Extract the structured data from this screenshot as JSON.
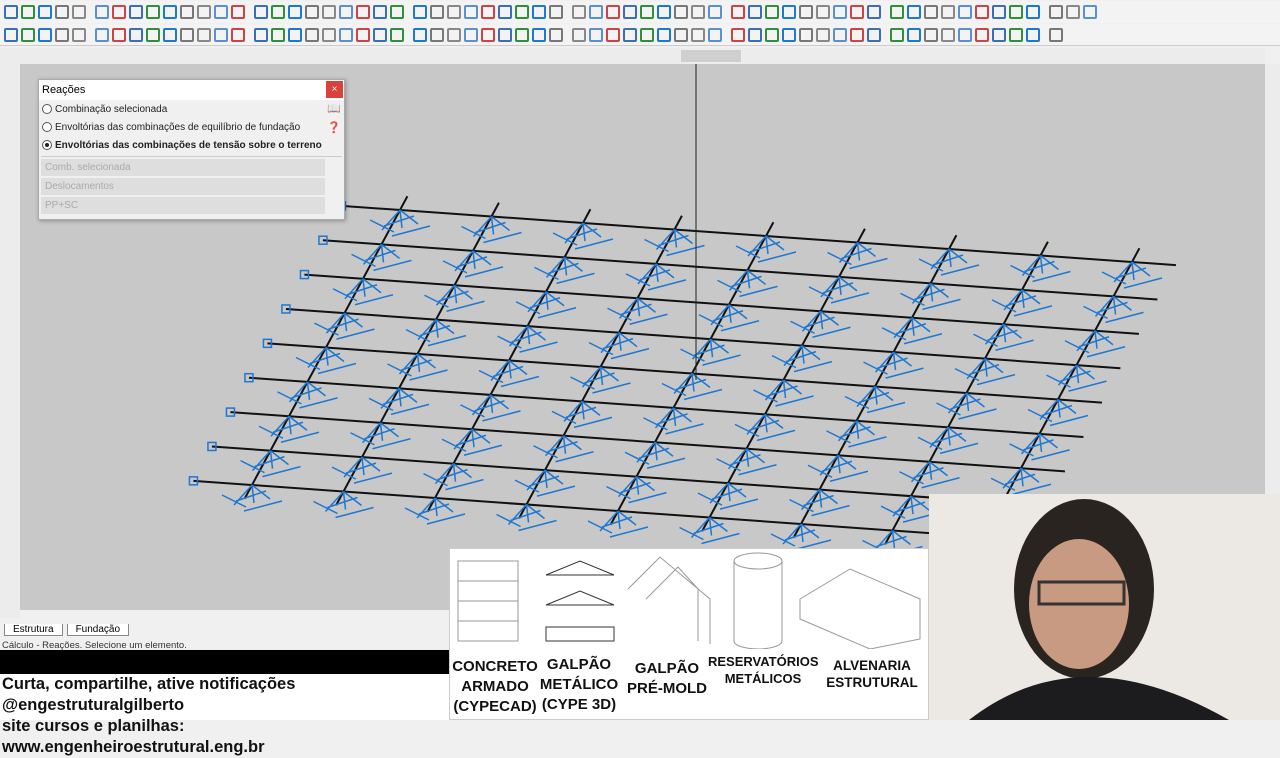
{
  "toolbar": {
    "row1_icon_count": 62,
    "row2_icon_count": 60,
    "active_icon": "reactions-view-icon"
  },
  "dialog": {
    "title": "Reações",
    "close_label": "×",
    "options": [
      {
        "label": "Combinação selecionada",
        "selected": false
      },
      {
        "label": "Envoltórias das combinações de equilíbrio de fundação",
        "selected": false
      },
      {
        "label": "Envoltórias das combinações de tensão sobre o terreno",
        "selected": true
      }
    ],
    "comb_field": "Comb. selecionada",
    "type_select": "Deslocamentos",
    "load_select": "PP+SC"
  },
  "view": {
    "background": "#c8c8c8",
    "support_color": "#1e78d2",
    "beam_color": "#111111",
    "grid_rows": 9,
    "grid_cols": 9
  },
  "tabs": [
    {
      "label": "Estrutura"
    },
    {
      "label": "Fundação"
    }
  ],
  "status": "Cálculo - Reações. Selecione um elemento.",
  "promo": {
    "line1": "Curta, compartilhe, ative notificações @engestruturalgilberto",
    "line2": "site cursos e planilhas: www.engenheiroestrutural.eng.br"
  },
  "banner": [
    {
      "l1": "CONCRETO",
      "l2": "ARMADO",
      "l3": "(CYPECAD)"
    },
    {
      "l1": "GALPÃO",
      "l2": "METÁLICO",
      "l3": "(CYPE 3D)"
    },
    {
      "l1": "GALPÃO",
      "l2": "PRÉ-MOLD",
      "l3": ""
    },
    {
      "l1": "RESERVATÓRIOS",
      "l2": "METÁLICOS",
      "l3": ""
    },
    {
      "l1": "ALVENARIA",
      "l2": "ESTRUTURAL",
      "l3": ""
    }
  ]
}
